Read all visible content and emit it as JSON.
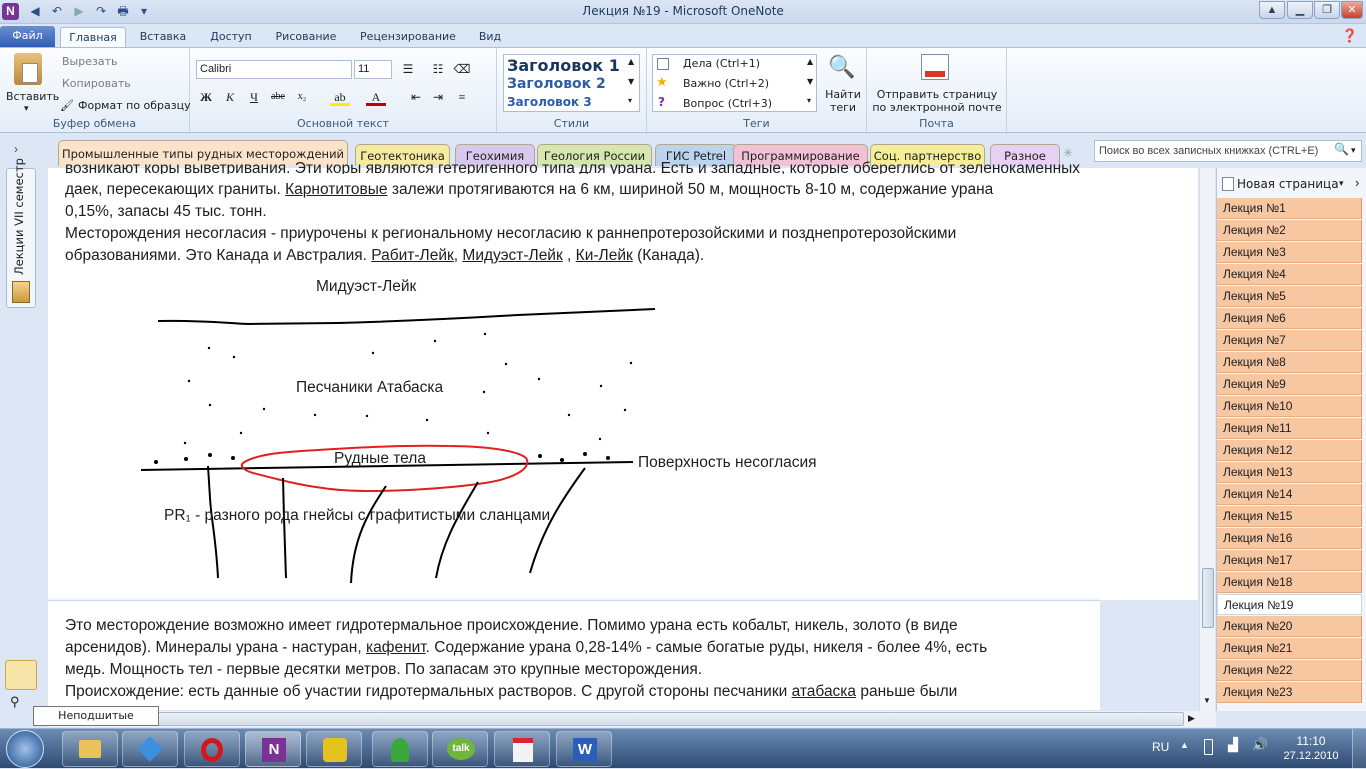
{
  "window": {
    "title": "Лекция №19  -  Microsoft OneNote"
  },
  "ribbon_tabs": {
    "file": "Файл",
    "home": "Главная",
    "insert": "Вставка",
    "share": "Доступ",
    "draw": "Рисование",
    "review": "Рецензирование",
    "view": "Вид"
  },
  "clipboard": {
    "paste": "Вставить",
    "cut": "Вырезать",
    "copy": "Копировать",
    "format": "Формат по образцу",
    "label": "Буфер обмена"
  },
  "font": {
    "name": "Calibri",
    "size": "11",
    "label": "Основной текст"
  },
  "styles": {
    "h1": "Заголовок 1",
    "h2": "Заголовок 2",
    "h3": "Заголовок 3",
    "label": "Стили"
  },
  "tags": {
    "todo": "Дела (Ctrl+1)",
    "important": "Важно (Ctrl+2)",
    "question": "Вопрос (Ctrl+3)",
    "find": "Найти теги",
    "label": "Теги"
  },
  "mail": {
    "send": "Отправить страницу по электронной почте",
    "label": "Почта"
  },
  "sections": [
    "Промышленные типы рудных месторождений",
    "Геотектоника",
    "Геохимия",
    "Геология России",
    "ГИС Petrel",
    "Программирование",
    "Соц. партнерство",
    "Разное"
  ],
  "section_colors": [
    "#fbe3c9",
    "#f5eba0",
    "#d7c8ee",
    "#d6e6ae",
    "#bcd3ee",
    "#f2c1d6",
    "#f5ee98",
    "#e7d1f3"
  ],
  "search": {
    "placeholder": "Поиск во всех записных книжках (CTRL+E)"
  },
  "notebook": {
    "name": "Лекции VII семестр"
  },
  "note": {
    "line0": "возникают коры выветривания. Эти коры являются гетеригенного типа для урана. Есть и западные, которые обереглись от зеленокаменных",
    "line1_a": "даек, пересекающих граниты. ",
    "line1_b": "Карнотитовые",
    "line1_c": " залежи протягиваются на 6 км, шириной 50 м, мощность 8-10 м, содержание урана",
    "line2": "0,15%, запасы 45 тыс. тонн.",
    "line3": "Месторождения несогласия - приурочены к региональному несогласию к раннепротерозойскими и позднепротерозойскими",
    "line4_a": "образованиями. Это Канада и Австралия. ",
    "line4_b": "Рабит-Лейк",
    "line4_c": ", ",
    "line4_d": "Мидуэст-Лейк",
    "line4_e": " , ",
    "line4_f": "Ки-Лейк",
    "line4_g": " (Канада)."
  },
  "diagram": {
    "title": "Мидуэст-Лейк",
    "sandstone": "Песчаники Атабаска",
    "ore": "Рудные тела",
    "surface": "Поверхность несогласия",
    "basement": "PR₁ - разного рода гнейсы с графитистыми сланцами"
  },
  "note2": {
    "l1": "Это месторождение возможно имеет гидротермальное происхождение.  Помимо урана есть кобальт, никель, золото (в виде",
    "l2_a": "арсенидов). Минералы урана - настуран, ",
    "l2_b": "кафенит",
    "l2_c": ". Содержание урана 0,28-14% - самые богатые руды, никеля - более 4%, есть",
    "l3": "медь. Мощность тел - первые десятки метров. По запасам это крупные месторождения.",
    "l4_a": "Происхождение: есть данные об участии гидротермальных растворов. С другой стороны песчаники ",
    "l4_b": "атабаска",
    "l4_c": " раньше были"
  },
  "pages": {
    "new_page": "Новая страница",
    "items": [
      "Лекция №1",
      "Лекция №2",
      "Лекция №3",
      "Лекция №4",
      "Лекция №5",
      "Лекция №6",
      "Лекция №7",
      "Лекция №8",
      "Лекция №9",
      "Лекция №10",
      "Лекция №11",
      "Лекция №12",
      "Лекция №13",
      "Лекция №14",
      "Лекция №15",
      "Лекция №16",
      "Лекция №17",
      "Лекция №18",
      "Лекция №19",
      "Лекция №20",
      "Лекция №21",
      "Лекция №22",
      "Лекция №23"
    ],
    "selected": "Лекция №19"
  },
  "tooltip": "Неподшитые заметки",
  "taskbar": {
    "lang": "RU",
    "time": "11:10",
    "date": "27.12.2010"
  }
}
